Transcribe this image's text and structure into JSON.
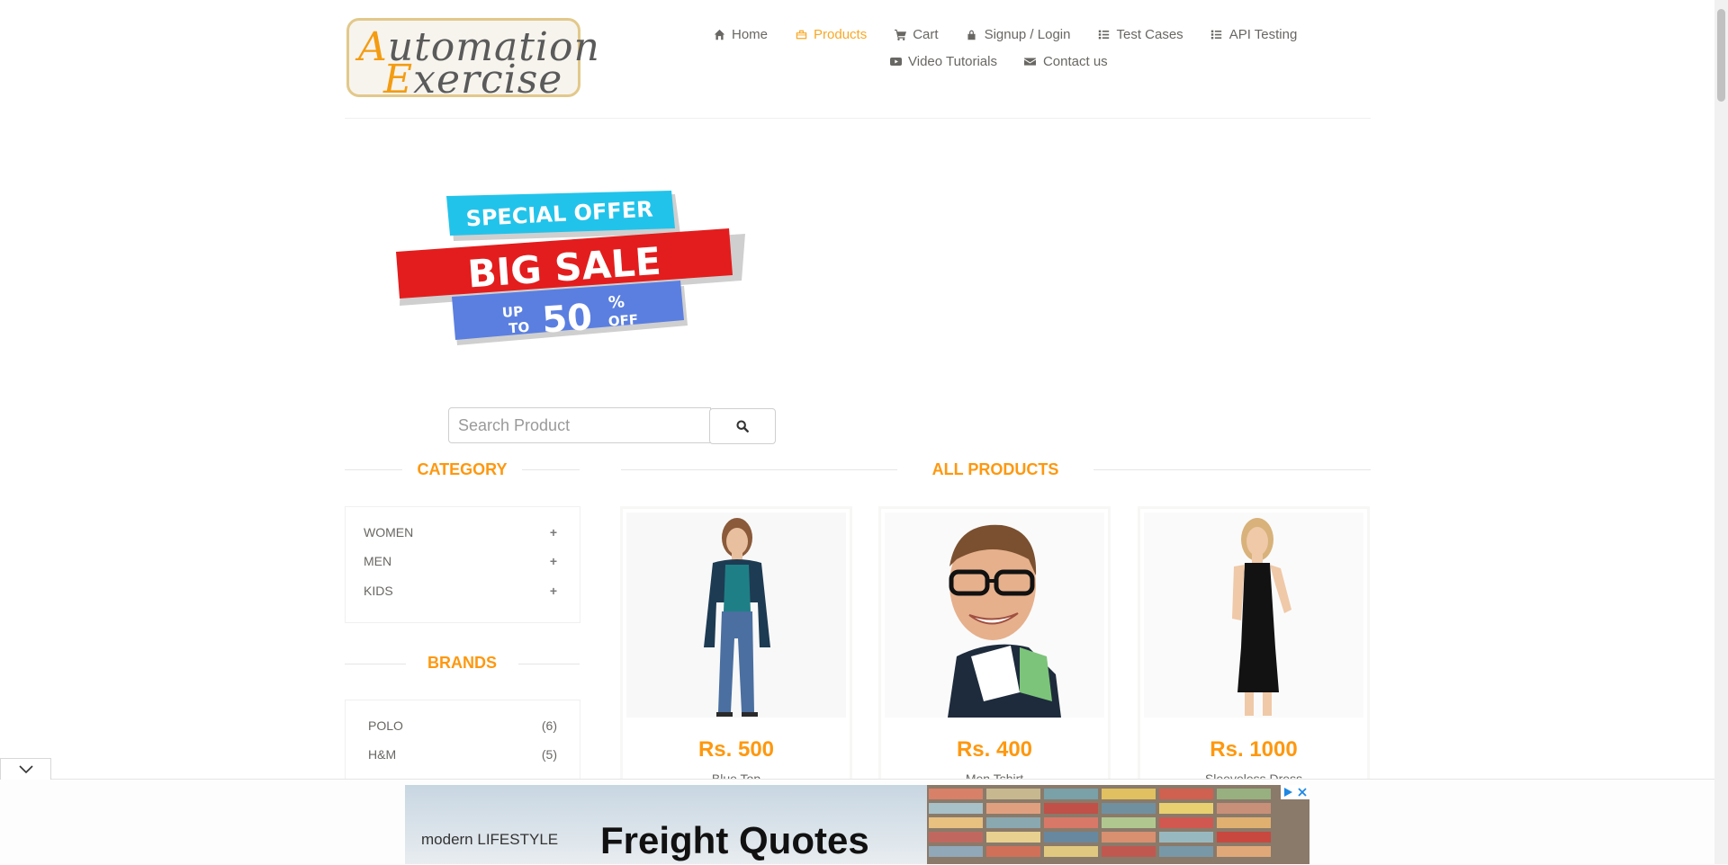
{
  "logo": {
    "line1": "Automation",
    "line2": "Exercise"
  },
  "nav": {
    "row1": [
      {
        "label": "Home",
        "icon": "home-icon"
      },
      {
        "label": "Products",
        "icon": "products-icon",
        "active": true
      },
      {
        "label": "Cart",
        "icon": "cart-icon"
      },
      {
        "label": "Signup / Login",
        "icon": "lock-icon"
      },
      {
        "label": "Test Cases",
        "icon": "list-icon"
      },
      {
        "label": "API Testing",
        "icon": "list-icon"
      }
    ],
    "row2": [
      {
        "label": "Video Tutorials",
        "icon": "youtube-icon"
      },
      {
        "label": "Contact us",
        "icon": "envelope-icon"
      }
    ]
  },
  "banner": {
    "top": "SPECIAL OFFER",
    "middle": "BIG SALE",
    "up": "UP",
    "to": "TO",
    "pct": "50",
    "percent_sign": "%",
    "off": "OFF"
  },
  "search": {
    "placeholder": "Search Product"
  },
  "category": {
    "title": "CATEGORY",
    "items": [
      {
        "label": "WOMEN"
      },
      {
        "label": "MEN"
      },
      {
        "label": "KIDS"
      }
    ],
    "expand_symbol": "+"
  },
  "brands": {
    "title": "BRANDS",
    "items": [
      {
        "label": "POLO",
        "count": "(6)"
      },
      {
        "label": "H&M",
        "count": "(5)"
      }
    ]
  },
  "products": {
    "title": "ALL PRODUCTS",
    "items": [
      {
        "price": "Rs. 500",
        "name": "Blue Top"
      },
      {
        "price": "Rs. 400",
        "name": "Men Tshirt"
      },
      {
        "price": "Rs. 1000",
        "name": "Sleeveless Dress"
      }
    ]
  },
  "ad": {
    "brand": "modern LIFESTYLE",
    "headline": "Freight Quotes"
  },
  "colors": {
    "accent": "#fe980f",
    "nav_active": "#f9a825",
    "text": "#696763",
    "sale_red": "#e31d1d",
    "sale_cyan": "#22c3ea",
    "sale_blue": "#5b7fe0"
  }
}
